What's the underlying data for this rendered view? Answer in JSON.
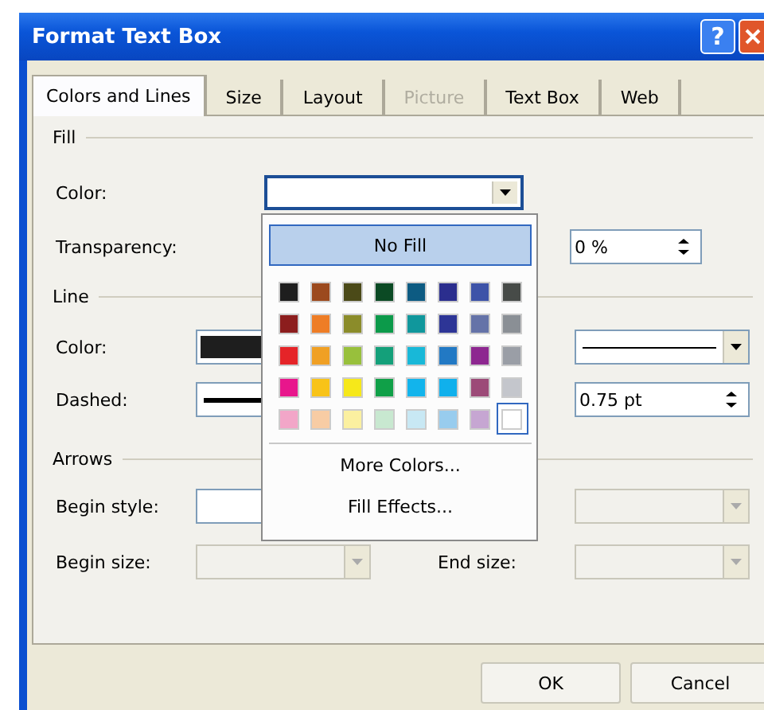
{
  "window": {
    "title": "Format Text Box",
    "help_button": "?"
  },
  "tabs": [
    {
      "label": "Colors and Lines",
      "selected": true,
      "disabled": false
    },
    {
      "label": "Size",
      "selected": false,
      "disabled": false
    },
    {
      "label": "Layout",
      "selected": false,
      "disabled": false
    },
    {
      "label": "Picture",
      "selected": false,
      "disabled": true
    },
    {
      "label": "Text Box",
      "selected": false,
      "disabled": false
    },
    {
      "label": "Web",
      "selected": false,
      "disabled": false
    }
  ],
  "fill": {
    "heading": "Fill",
    "color": {
      "label": "Color:",
      "expanded": true
    },
    "transparency": {
      "label": "Transparency:",
      "value": "0 %"
    }
  },
  "line": {
    "heading": "Line",
    "color": {
      "label": "Color:"
    },
    "dashed": {
      "label": "Dashed:"
    },
    "style": {
      "disabled": false
    },
    "weight": {
      "value": "0.75 pt"
    }
  },
  "arrows": {
    "heading": "Arrows",
    "begin_style": {
      "label": "Begin style:"
    },
    "end_style": {
      "disabled": true
    },
    "begin_size": {
      "label": "Begin size:",
      "disabled": true
    },
    "end_size": {
      "label": "End size:",
      "disabled": true
    }
  },
  "color_popup": {
    "no_fill": "No Fill",
    "swatches": [
      {
        "color": "#1e1e1e",
        "selected": false
      },
      {
        "color": "#9c4a1e",
        "selected": false
      },
      {
        "color": "#4b4a18",
        "selected": false
      },
      {
        "color": "#0b4a24",
        "selected": false
      },
      {
        "color": "#0d5b82",
        "selected": false
      },
      {
        "color": "#2b2e8e",
        "selected": false
      },
      {
        "color": "#3d53a8",
        "selected": false
      },
      {
        "color": "#474b48",
        "selected": false
      },
      {
        "color": "#8c1d1d",
        "selected": false
      },
      {
        "color": "#ee7d26",
        "selected": false
      },
      {
        "color": "#8b8c2a",
        "selected": false
      },
      {
        "color": "#0c9a4a",
        "selected": false
      },
      {
        "color": "#10979c",
        "selected": false
      },
      {
        "color": "#2d3596",
        "selected": false
      },
      {
        "color": "#6573a8",
        "selected": false
      },
      {
        "color": "#8a8f95",
        "selected": false
      },
      {
        "color": "#e52428",
        "selected": false
      },
      {
        "color": "#f0a024",
        "selected": false
      },
      {
        "color": "#98c03c",
        "selected": false
      },
      {
        "color": "#14a07a",
        "selected": false
      },
      {
        "color": "#18b8d8",
        "selected": false
      },
      {
        "color": "#2279c4",
        "selected": false
      },
      {
        "color": "#8d2790",
        "selected": false
      },
      {
        "color": "#9a9ea6",
        "selected": false
      },
      {
        "color": "#e8168c",
        "selected": false
      },
      {
        "color": "#f8c318",
        "selected": false
      },
      {
        "color": "#f6e81a",
        "selected": false
      },
      {
        "color": "#10a048",
        "selected": false
      },
      {
        "color": "#12b4ec",
        "selected": false
      },
      {
        "color": "#10b0ec",
        "selected": false
      },
      {
        "color": "#9c4a78",
        "selected": false
      },
      {
        "color": "#c4c6cc",
        "selected": false
      },
      {
        "color": "#f2a6c8",
        "selected": false
      },
      {
        "color": "#f8cca4",
        "selected": false
      },
      {
        "color": "#fbf0a0",
        "selected": false
      },
      {
        "color": "#c8e8d0",
        "selected": false
      },
      {
        "color": "#c8e8f4",
        "selected": false
      },
      {
        "color": "#98ccee",
        "selected": false
      },
      {
        "color": "#c6a6d2",
        "selected": false
      },
      {
        "color": "#ffffff",
        "selected": true
      }
    ],
    "more_colors": "More Colors...",
    "fill_effects": "Fill Effects..."
  },
  "buttons": [
    {
      "label": "OK"
    },
    {
      "label": "Cancel"
    }
  ]
}
